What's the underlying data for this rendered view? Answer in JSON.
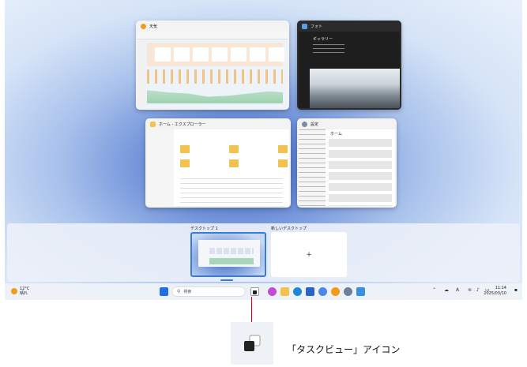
{
  "windows": {
    "weather": {
      "title": "天気"
    },
    "photos": {
      "title": "フォト",
      "heading": "ギャラリー"
    },
    "explorer": {
      "title": "ホーム - エクスプローラー"
    },
    "settings": {
      "title": "設定",
      "heading": "ホーム"
    }
  },
  "desktops": [
    {
      "label": "デスクトップ 1"
    },
    {
      "label": "新しいデスクトップ",
      "add_symbol": "+"
    }
  ],
  "taskbar": {
    "weather_temp": "12°C",
    "weather_desc": "晴れ",
    "search_placeholder": "検索",
    "tray_font_indicator": "A",
    "time": "11:14",
    "date": "2025/03/10"
  },
  "callout": {
    "label": "「タスクビュー」アイコン",
    "line_color": "#d4001f"
  },
  "colors": {
    "accent": "#3a7bd5",
    "folder": "#f2c14e"
  }
}
